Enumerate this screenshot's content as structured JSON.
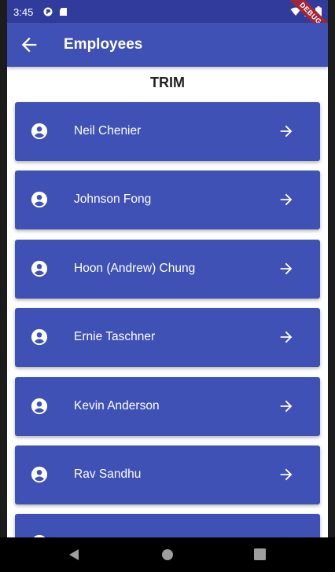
{
  "status_bar": {
    "time": "3:45"
  },
  "debug_banner": "DEBUG",
  "app_bar": {
    "title": "Employees"
  },
  "section": {
    "title": "TRIM"
  },
  "employees": [
    {
      "name": "Neil Chenier"
    },
    {
      "name": "Johnson Fong"
    },
    {
      "name": "Hoon (Andrew) Chung"
    },
    {
      "name": "Ernie Taschner"
    },
    {
      "name": "Kevin Anderson"
    },
    {
      "name": "Rav Sandhu"
    },
    {
      "name": ""
    }
  ],
  "colors": {
    "app_bar": "#3f51b5",
    "status_bar": "#313b9c",
    "card": "#3f51b5",
    "debug": "#a0263a"
  },
  "icons": {
    "back": "arrow-left-icon",
    "avatar": "account-circle-icon",
    "forward": "arrow-right-icon"
  }
}
